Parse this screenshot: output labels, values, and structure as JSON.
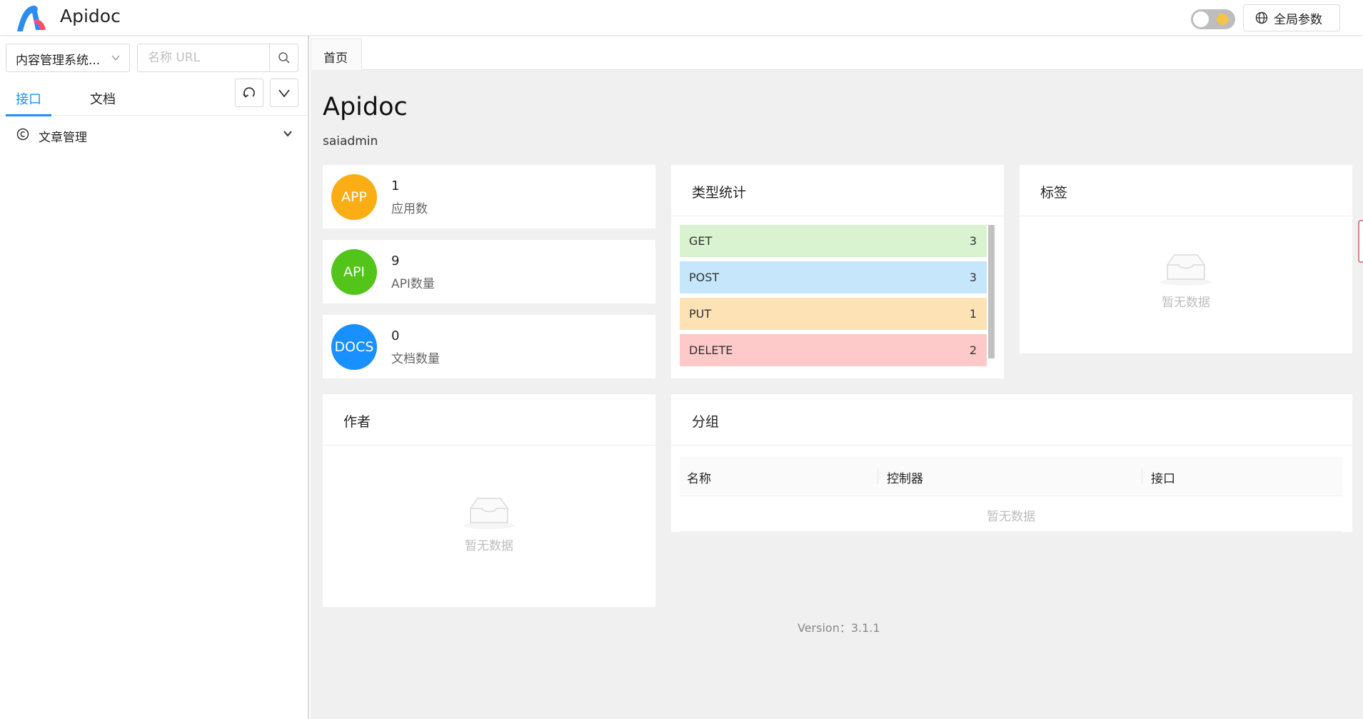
{
  "header": {
    "brand": "Apidoc",
    "global_params_label": "全局参数",
    "theme_toggle": "off"
  },
  "sidebar": {
    "project_select": "内容管理系统...",
    "search_placeholder": "名称 URL",
    "tabs": [
      {
        "label": "接口",
        "active": true
      },
      {
        "label": "文档",
        "active": false
      }
    ],
    "tree": [
      {
        "label": "文章管理"
      }
    ]
  },
  "main": {
    "tabs": [
      {
        "label": "首页"
      }
    ],
    "title": "Apidoc",
    "subtitle": "saiadmin",
    "stats": [
      {
        "badge": "APP",
        "value": "1",
        "label": "应用数",
        "color": "#faad14"
      },
      {
        "badge": "API",
        "value": "9",
        "label": "API数量",
        "color": "#52c41a"
      },
      {
        "badge": "DOCS",
        "value": "0",
        "label": "文档数量",
        "color": "#1890ff"
      }
    ],
    "type_stats": {
      "title": "类型统计",
      "rows": [
        {
          "name": "GET",
          "count": "3",
          "color": "#d9f2d0"
        },
        {
          "name": "POST",
          "count": "3",
          "color": "#c6e7fb"
        },
        {
          "name": "PUT",
          "count": "1",
          "color": "#fde2b5"
        },
        {
          "name": "DELETE",
          "count": "2",
          "color": "#fdc9c9"
        }
      ]
    },
    "tags": {
      "title": "标签",
      "empty_text": "暂无数据"
    },
    "authors": {
      "title": "作者",
      "empty_text": "暂无数据"
    },
    "groups": {
      "title": "分组",
      "columns": [
        "名称",
        "控制器",
        "接口"
      ],
      "empty_text": "暂无数据"
    },
    "version": "Version：3.1.1"
  }
}
